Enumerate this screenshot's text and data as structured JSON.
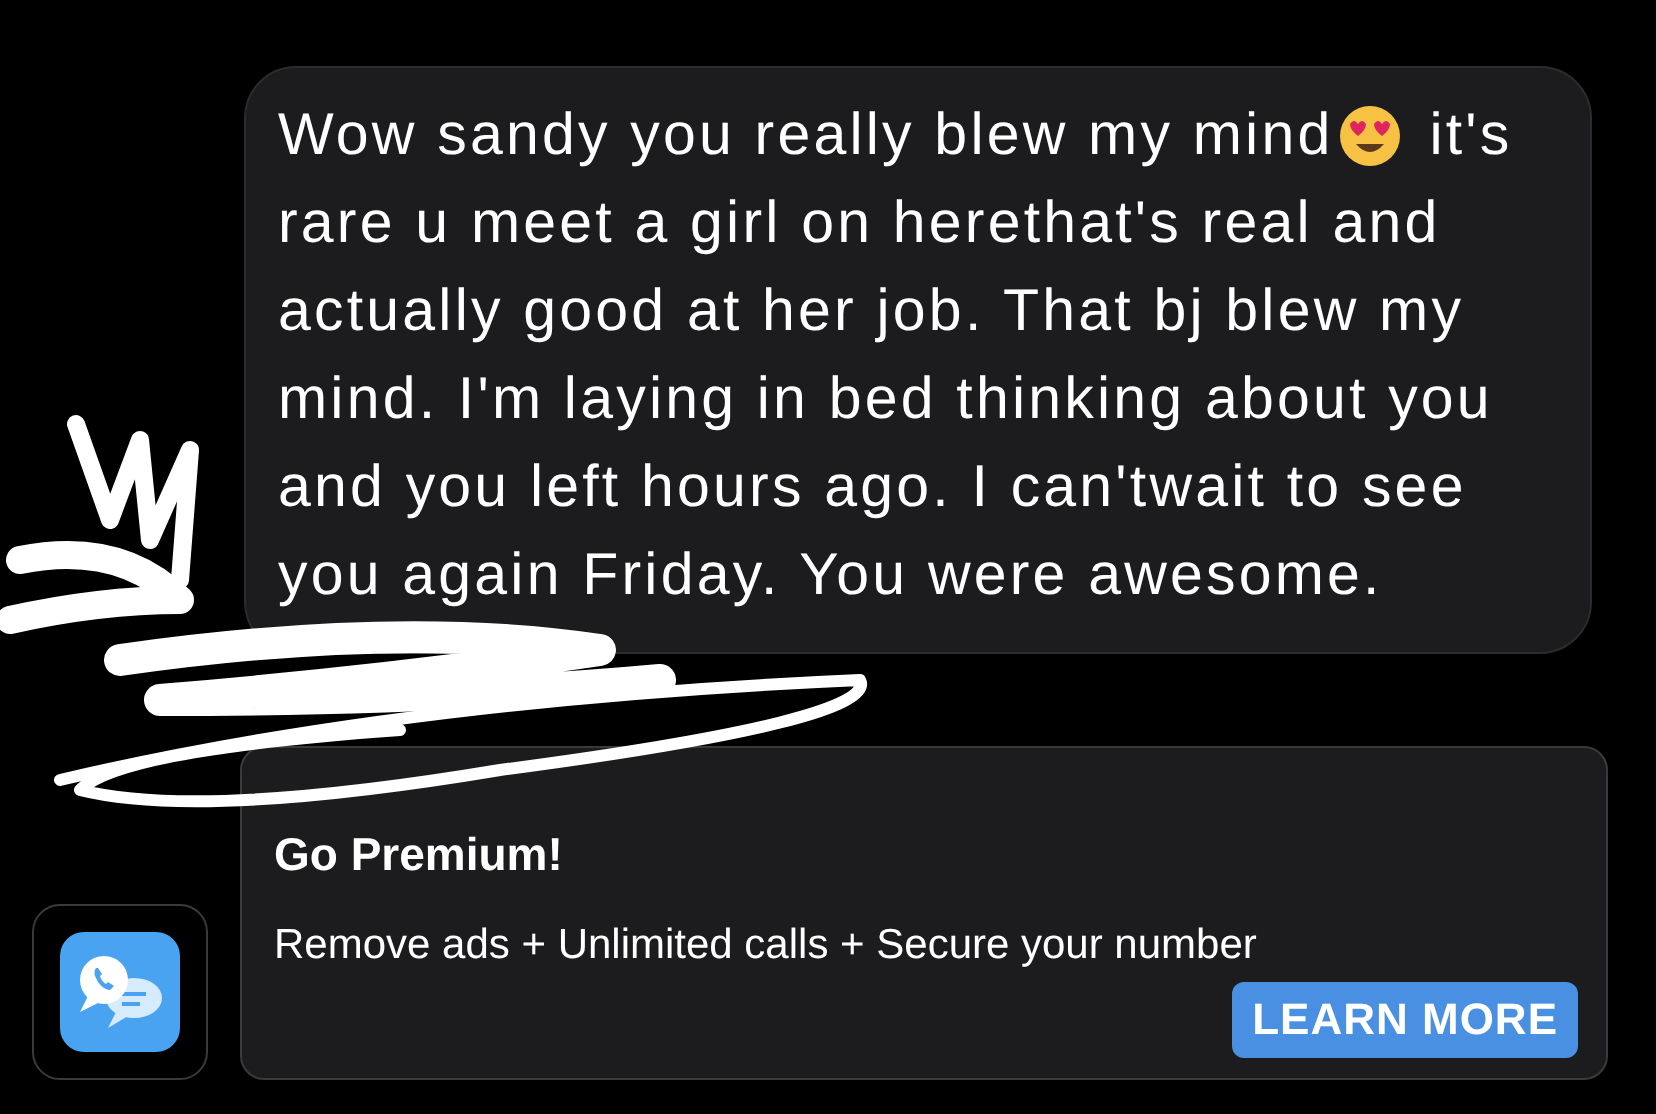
{
  "message": {
    "text_parts": [
      "Wow sandy you really blew my mind",
      "it's",
      "rare u meet a girl on herethat's real and actually good at her job. That bj blew my mind. I'm laying in bed thinking about you and you left hours ago. I can'twait to see you again Friday. You were awesome."
    ]
  },
  "ad": {
    "title": "Go Premium!",
    "description": "Remove ads + Unlimited calls + Secure your number",
    "button": "LEARN MORE"
  }
}
